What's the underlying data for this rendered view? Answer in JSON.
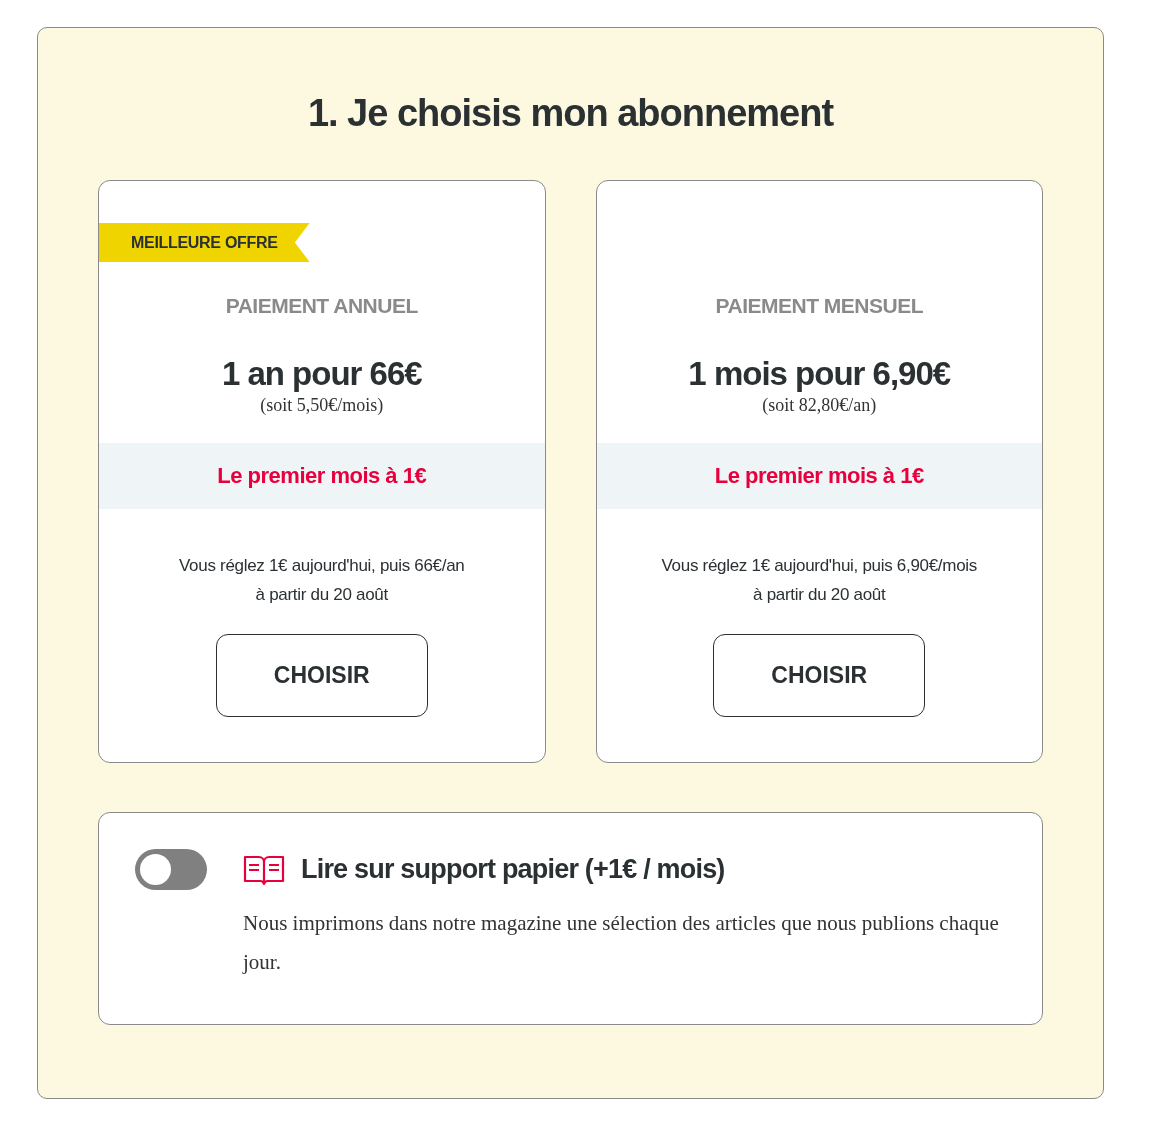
{
  "title": "1. Je choisis mon abonnement",
  "plans": [
    {
      "badge": "MEILLEURE OFFRE",
      "label": "PAIEMENT ANNUEL",
      "price": "1 an pour 66€",
      "note": "(soit 5,50€/mois)",
      "promo": "Le premier mois à 1€",
      "description_lines": [
        "Vous réglez 1€ aujourd'hui, puis 66€/an",
        "à partir du 20 août"
      ],
      "button": "CHOISIR"
    },
    {
      "label": "PAIEMENT MENSUEL",
      "price": "1 mois pour 6,90€",
      "note": "(soit 82,80€/an)",
      "promo": "Le premier mois à 1€",
      "description_lines": [
        "Vous réglez 1€ aujourd'hui, puis 6,90€/mois",
        "à partir du 20 août"
      ],
      "button": "CHOISIR"
    }
  ],
  "option": {
    "checked": false,
    "title": "Lire sur support papier (+1€ / mois)",
    "description": "Nous imprimons dans notre magazine une sélection des articles que nous publions chaque jour."
  }
}
